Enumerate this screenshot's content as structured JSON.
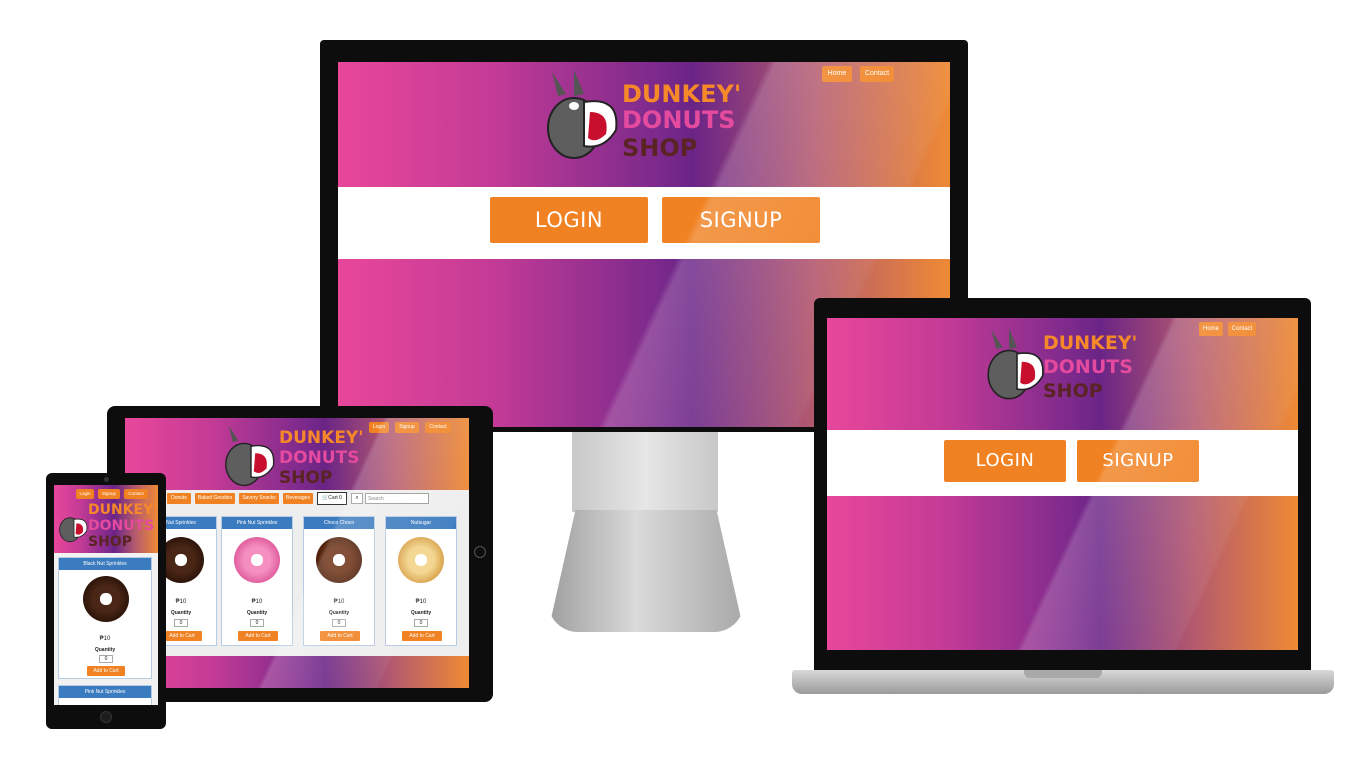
{
  "brand": {
    "line1": "DUNKEY'",
    "line2": "DONUTS",
    "line3": "SHOP"
  },
  "nav": {
    "home": "Home",
    "contact": "Contact",
    "login": "Login",
    "signup": "Signup"
  },
  "hero": {
    "login": "LOGIN",
    "signup": "SIGNUP"
  },
  "shop": {
    "categories": [
      "Donuts",
      "Baked Goodies",
      "Savory Snacks",
      "Beverages"
    ],
    "cart": "Cart 0",
    "search_placeholder": "Search",
    "quantity_label": "Quantity",
    "qty_value": "0",
    "add_label": "Add to Cart",
    "products": [
      {
        "name": "Black Nut Sprinkles",
        "price": "₱10"
      },
      {
        "name": "Pink Nut Sprinkles",
        "price": "₱10"
      },
      {
        "name": "Choco Choco",
        "price": "₱10"
      },
      {
        "name": "Nutsugar",
        "price": "₱10"
      }
    ],
    "tablet_first_label": "Nut Sprinkles"
  },
  "colors": {
    "accent": "#f08223",
    "card_header": "#3b7bbf",
    "gradient": [
      "#e8479a",
      "#7c2a8c",
      "#ee8a34"
    ]
  }
}
